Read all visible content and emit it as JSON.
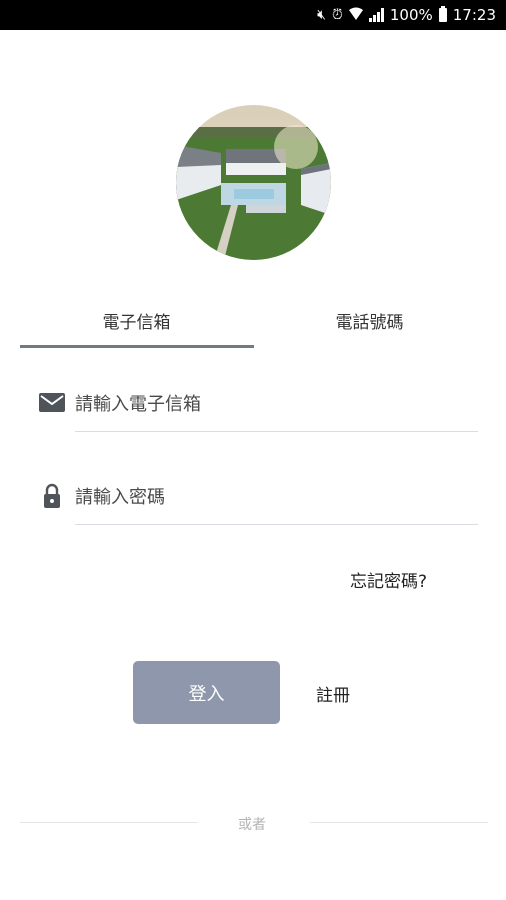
{
  "status_bar": {
    "battery": "100%",
    "time": "17:23"
  },
  "tabs": [
    {
      "label": "電子信箱",
      "active": true
    },
    {
      "label": "電話號碼",
      "active": false
    }
  ],
  "email_field": {
    "placeholder": "請輸入電子信箱",
    "icon": "mail-icon"
  },
  "password_field": {
    "placeholder": "請輸入密碼",
    "icon": "lock-icon"
  },
  "forgot_password": "忘記密碼?",
  "login_button": "登入",
  "register_link": "註冊",
  "divider_text": "或者",
  "colors": {
    "primary_button": "#8e97ab",
    "tab_underline": "#717b84",
    "icon": "#4f545a"
  }
}
